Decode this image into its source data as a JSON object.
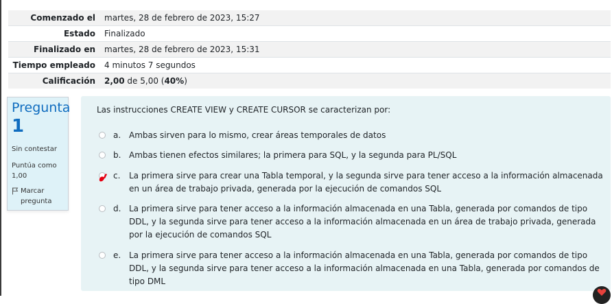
{
  "summary": [
    {
      "label": "Comenzado el",
      "value": "martes, 28 de febrero de 2023, 15:27"
    },
    {
      "label": "Estado",
      "value": "Finalizado"
    },
    {
      "label": "Finalizado en",
      "value": "martes, 28 de febrero de 2023, 15:31"
    },
    {
      "label": "Tiempo empleado",
      "value": "4 minutos 7 segundos"
    },
    {
      "label": "Calificación",
      "score": "2,00",
      "mid": " de 5,00 (",
      "percent": "40%",
      "end": ")"
    }
  ],
  "question": {
    "label": "Pregunta",
    "number": "1",
    "state": "Sin contestar",
    "grade": "Puntúa como 1,00",
    "flag_label": "Marcar pregunta",
    "text": "Las instrucciones CREATE VIEW y CREATE CURSOR se caracterizan por:",
    "options": [
      {
        "letter": "a.",
        "text": "Ambas sirven para lo mismo, crear áreas temporales de datos"
      },
      {
        "letter": "b.",
        "text": "Ambas tienen efectos similares; la primera para SQL, y la segunda para PL/SQL"
      },
      {
        "letter": "c.",
        "text": "La primera sirve para crear una Tabla temporal, y la segunda sirve para tener acceso a la información almacenada en un área de trabajo privada, generada por la ejecución de comandos SQL"
      },
      {
        "letter": "d.",
        "text": "La primera sirve para tener acceso a la información almacenada en una Tabla, generada por comandos de tipo DDL, y la segunda sirve para tener acceso a la información almacenada en un área de trabajo privada, generada por la ejecución de comandos SQL"
      },
      {
        "letter": "e.",
        "text": "La primera sirve para tener acceso a la información almacenada en una Tabla, generada por comandos de tipo DDL, y la segunda sirve para tener acceso a la información almacenada en una Tabla, generada por comandos de tipo DML"
      }
    ]
  },
  "colors": {
    "accent": "#0f6cbf",
    "info_bg": "#def2f8",
    "content_bg": "#e7f3f5",
    "marker": "#e60012"
  },
  "icons": {
    "flag": "flag-icon",
    "marker": "red-pen-mark-icon",
    "help": "heart-icon"
  }
}
